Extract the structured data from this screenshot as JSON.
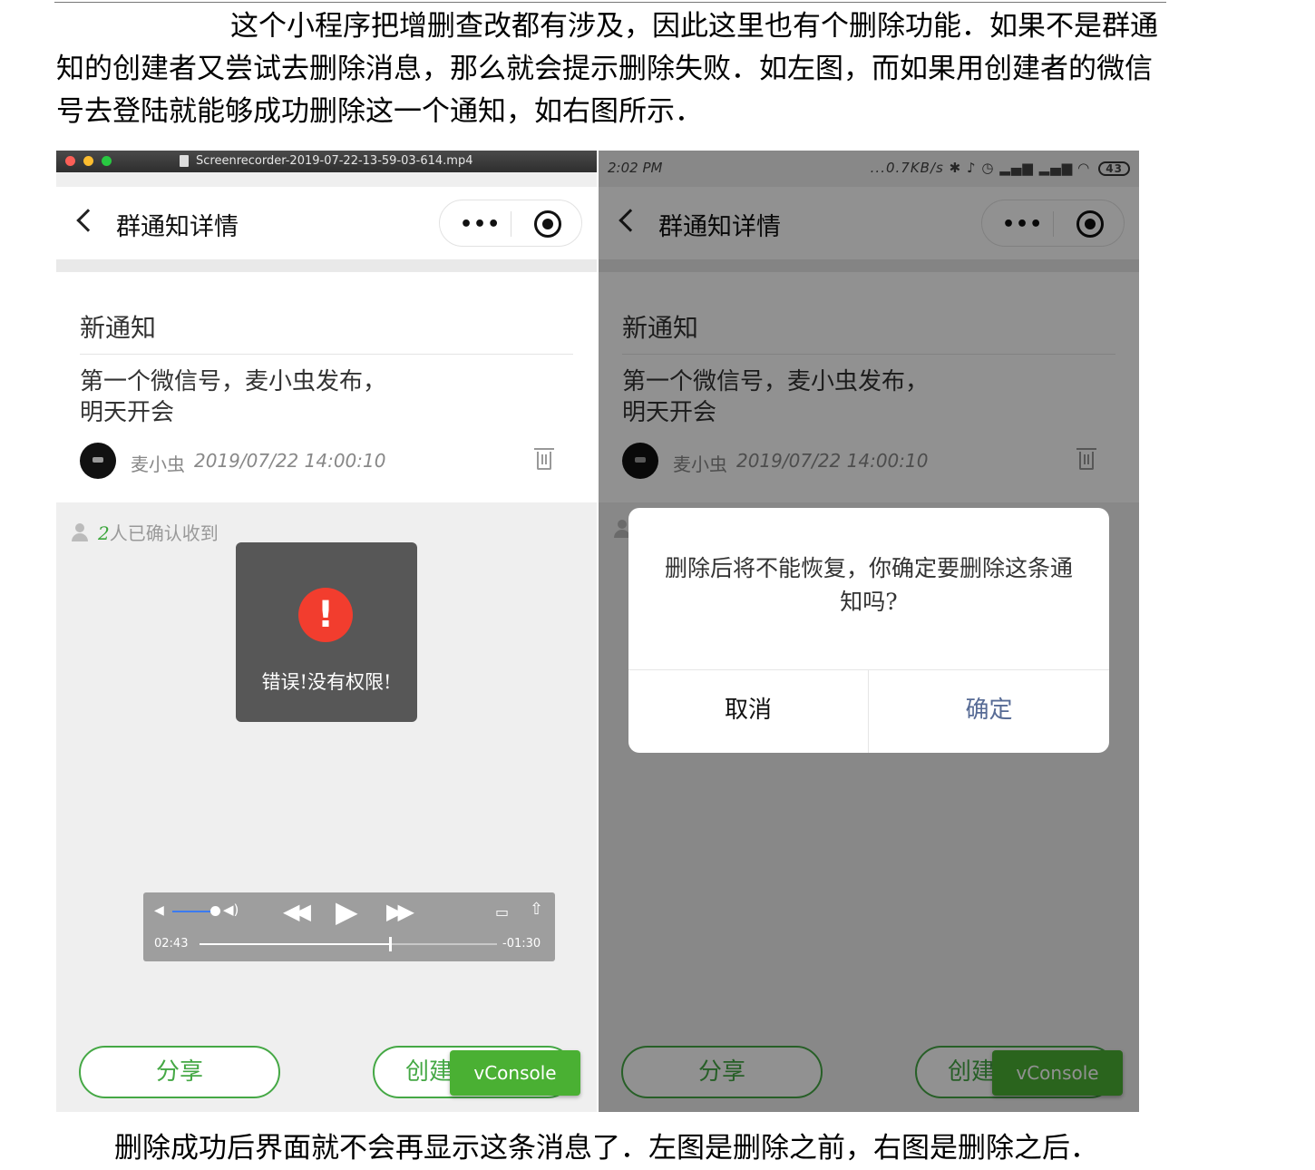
{
  "paragraphs": {
    "intro": "这个小程序把增删查改都有涉及，因此这里也有个删除功能．如果不是群通知的创建者又尝试去删除消息，那么就会提示删除失败．如左图，而如果用创建者的微信号去登陆就能够成功删除这一个通知，如右图所示．",
    "outro": "删除成功后界面就不会再显示这条消息了．左图是删除之前，右图是删除之后．"
  },
  "left_screenshot": {
    "mac_titlebar": {
      "filename": "Screenrecorder-2019-07-22-13-59-03-614.mp4"
    },
    "nav": {
      "title": "群通知详情",
      "more_label": "•••"
    },
    "notice": {
      "title": "新通知",
      "body_line1": "第一个微信号，麦小虫发布，",
      "body_line2": "明天开会",
      "author": "麦小虫",
      "time": "2019/07/22 14:00:10"
    },
    "confirm": {
      "count": "2",
      "text": "人已确认收到"
    },
    "toast": {
      "icon": "!",
      "text": "错误!没有权限!"
    },
    "video_controls": {
      "elapsed": "02:43",
      "remaining": "-01:30",
      "progress": 0.64,
      "volume": 0.75
    },
    "buttons": {
      "share": "分享",
      "create": "创建",
      "vconsole": "vConsole"
    }
  },
  "right_screenshot": {
    "statusbar": {
      "time": "2:02 PM",
      "speed": "...0.7KB/s",
      "battery": "43"
    },
    "nav": {
      "title": "群通知详情",
      "more_label": "•••"
    },
    "notice": {
      "title": "新通知",
      "body_line1": "第一个微信号，麦小虫发布，",
      "body_line2": "明天开会",
      "author": "麦小虫",
      "time": "2019/07/22 14:00:10"
    },
    "modal": {
      "message": "删除后将不能恢复，你确定要删除这条通知吗?",
      "cancel": "取消",
      "confirm": "确定"
    },
    "buttons": {
      "share": "分享",
      "create": "创建",
      "vconsole": "vConsole"
    }
  },
  "colors": {
    "accent_green": "#45a845",
    "error_red": "#f23d2e",
    "dialog_link_blue": "#576b95",
    "vconsole_green": "#4ab033"
  },
  "icons": [
    "back-chevron-icon",
    "more-dots-icon",
    "target-icon",
    "trash-icon",
    "person-icon",
    "error-icon",
    "volume-icon",
    "rewind-icon",
    "play-icon",
    "forward-icon",
    "airplay-icon",
    "share-icon",
    "bluetooth-icon",
    "wifi-icon",
    "battery-icon"
  ]
}
